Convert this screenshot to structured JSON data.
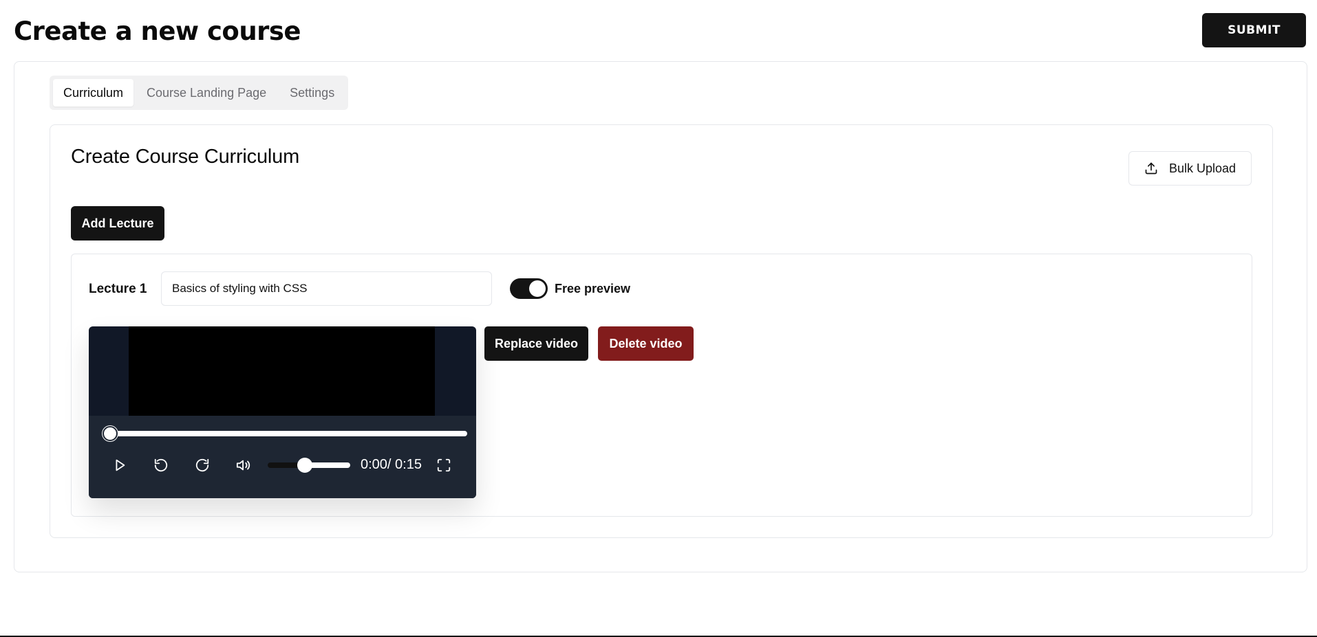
{
  "page": {
    "title": "Create a new course",
    "submit_label": "SUBMIT"
  },
  "tabs": [
    {
      "label": "Curriculum",
      "active": true
    },
    {
      "label": "Course Landing Page",
      "active": false
    },
    {
      "label": "Settings",
      "active": false
    }
  ],
  "curriculum": {
    "title": "Create Course Curriculum",
    "bulk_upload_label": "Bulk Upload",
    "add_lecture_label": "Add Lecture"
  },
  "lecture": {
    "label": "Lecture 1",
    "title_value": "Basics of styling with CSS",
    "free_preview_label": "Free preview",
    "free_preview_on": true,
    "replace_label": "Replace video",
    "delete_label": "Delete video"
  },
  "video": {
    "current_time": "0:00",
    "duration": "0:15",
    "time_display": "0:00/ 0:15",
    "progress": 0,
    "volume": 0.6
  },
  "colors": {
    "primary": "#141414",
    "danger": "#821c1c",
    "border": "#e5e7eb",
    "player_bg": "#111827"
  }
}
